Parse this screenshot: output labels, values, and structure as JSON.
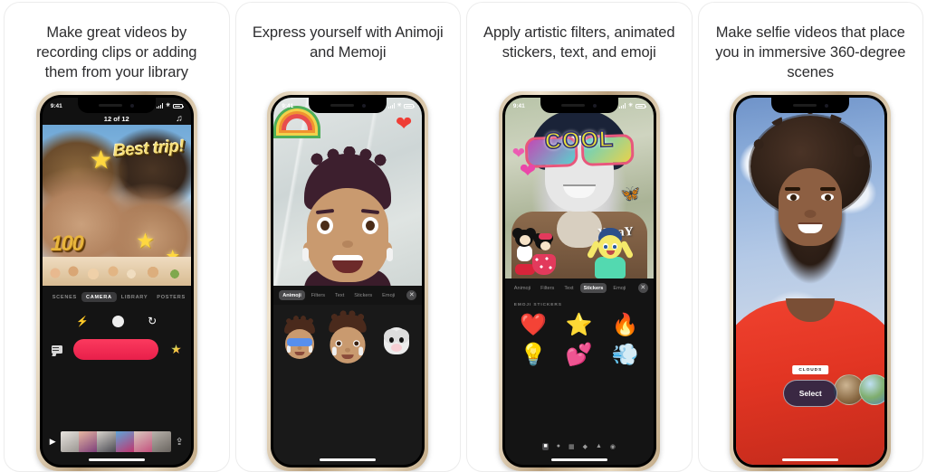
{
  "gallery": {
    "cards": [
      {
        "headline": "Make great videos by recording clips or adding them from your library",
        "phone": {
          "status": {
            "time": "9:41",
            "wifi_icon": "wifi-icon",
            "battery_icon": "battery-icon",
            "signal_icon": "cellular-signal-icon"
          },
          "title": "12 of 12",
          "music_icon": "music-note-icon",
          "photo": {
            "caption_text": "Best trip!",
            "overlay_text": "100",
            "stickers": [
              "star-sticker",
              "star-sticker",
              "star-sticker",
              "cake-sticker"
            ]
          },
          "tabs": [
            {
              "label": "SCENES",
              "active": false
            },
            {
              "label": "CAMERA",
              "active": true
            },
            {
              "label": "LIBRARY",
              "active": false
            },
            {
              "label": "POSTERS",
              "active": false
            }
          ],
          "camera_controls": {
            "flash_icon": "flash-icon",
            "shutter_icon": "photo-mode-icon",
            "flip_icon": "flip-camera-icon"
          },
          "record_row": {
            "captions_icon": "captions-icon",
            "record_label": "",
            "effects_icon": "effects-star-icon"
          },
          "timeline": {
            "play_icon": "play-icon",
            "share_icon": "share-icon"
          }
        }
      },
      {
        "headline": "Express yourself with Animoji and Memoji",
        "phone": {
          "status": {
            "time": "9:41",
            "wifi_icon": "wifi-icon",
            "battery_icon": "battery-icon",
            "signal_icon": "cellular-signal-icon"
          },
          "photo": {
            "stickers": [
              "rainbow-sticker",
              "heart-sticker"
            ],
            "subject": "memoji-character"
          },
          "toolbar": [
            {
              "label": "Animoji",
              "active": true
            },
            {
              "label": "Filters",
              "active": false
            },
            {
              "label": "Text",
              "active": false
            },
            {
              "label": "Stickers",
              "active": false
            },
            {
              "label": "Emoji",
              "active": false
            }
          ],
          "close_icon": "close-icon",
          "animoji_options": [
            "memoji-with-glasses",
            "memoji-portrait",
            "mouse-animoji"
          ]
        }
      },
      {
        "headline": "Apply artistic filters, animated stickers, text, and emoji",
        "phone": {
          "status": {
            "time": "9:41",
            "wifi_icon": "wifi-icon",
            "battery_icon": "battery-icon",
            "signal_icon": "cellular-signal-icon"
          },
          "photo": {
            "glasses_text": "COOL",
            "caption_text": "YaaaY",
            "stickers": [
              "pink-hearts-sticker",
              "butterfly-sticker",
              "mickey-mouse-sticker",
              "minnie-mouse-sticker",
              "joy-character-sticker"
            ]
          },
          "toolbar": [
            {
              "label": "Animoji",
              "active": false
            },
            {
              "label": "Filters",
              "active": false
            },
            {
              "label": "Text",
              "active": false
            },
            {
              "label": "Stickers",
              "active": true
            },
            {
              "label": "Emoji",
              "active": false
            }
          ],
          "close_icon": "close-icon",
          "panel_label": "EMOJI STICKERS",
          "stickers": [
            {
              "glyph": "❤️",
              "name": "red-heart-sticker"
            },
            {
              "glyph": "⭐",
              "name": "glowing-star-sticker"
            },
            {
              "glyph": "🔥",
              "name": "fire-sticker"
            },
            {
              "glyph": "💡",
              "name": "light-bulb-sticker"
            },
            {
              "glyph": "💕",
              "name": "two-hearts-sticker"
            },
            {
              "glyph": "💨",
              "name": "dash-cloud-sticker"
            }
          ],
          "bottom_icons": [
            "effects-icon",
            "filters-icon",
            "frame-icon",
            "shapes-icon",
            "alert-icon",
            "globe-icon"
          ]
        }
      },
      {
        "headline": "Make selfie videos that place you in immersive 360-degree scenes",
        "phone": {
          "scene_label": "CLOUDS",
          "select_label": "Select",
          "scene_thumbs": [
            "desert-scene-thumb",
            "landscape-scene-thumb"
          ]
        }
      }
    ]
  }
}
